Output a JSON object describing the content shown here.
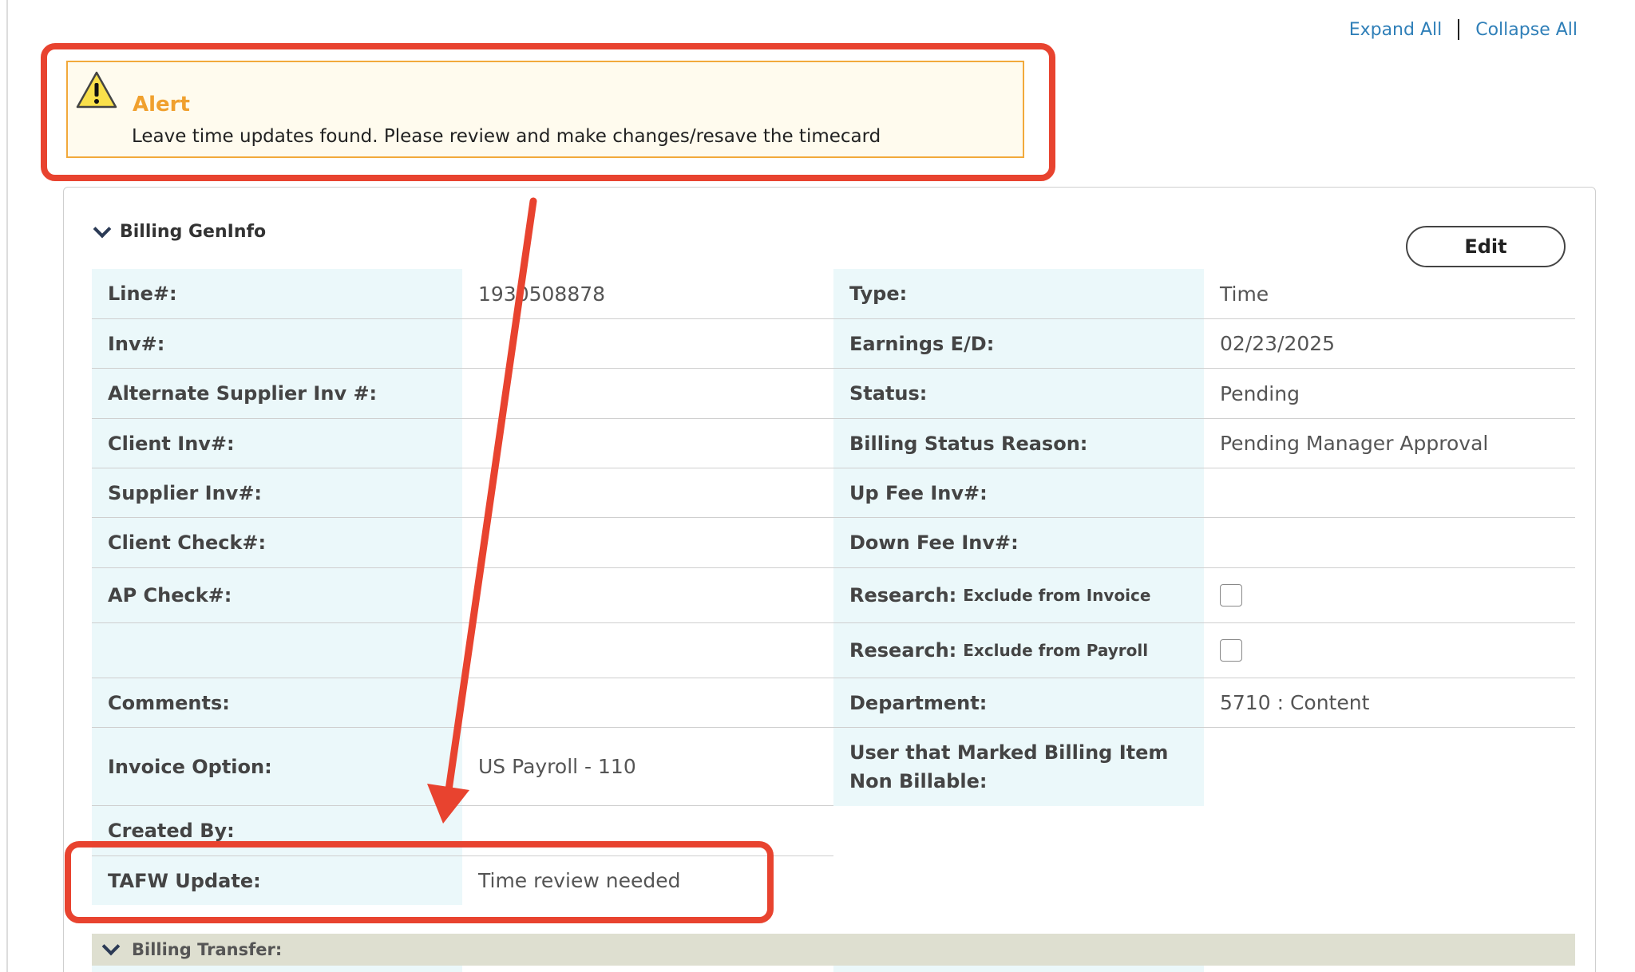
{
  "top_links": {
    "expand_all": "Expand All",
    "collapse_all": "Collapse All"
  },
  "alert": {
    "icon": "warning-triangle-icon",
    "title": "Alert",
    "message": "Leave time updates found. Please review and make changes/resave the timecard"
  },
  "section": {
    "title": "Billing GenInfo",
    "edit_label": "Edit"
  },
  "left_rows": [
    {
      "label": "Line#:",
      "value": "1930508878"
    },
    {
      "label": "Inv#:",
      "value": ""
    },
    {
      "label": "Alternate Supplier Inv #:",
      "value": ""
    },
    {
      "label": "Client Inv#:",
      "value": ""
    },
    {
      "label": "Supplier Inv#:",
      "value": ""
    },
    {
      "label": "Client Check#:",
      "value": ""
    },
    {
      "label": "AP Check#:",
      "value": ""
    },
    {
      "label": "",
      "value": ""
    },
    {
      "label": "Comments:",
      "value": ""
    },
    {
      "label": "Invoice Option:",
      "value": "US Payroll - 110"
    },
    {
      "label": "Created By:",
      "value": ""
    },
    {
      "label": "TAFW Update:",
      "value": "Time review needed"
    }
  ],
  "right_rows": [
    {
      "label": "Type:",
      "value": "Time"
    },
    {
      "label": "Earnings E/D:",
      "value": "02/23/2025"
    },
    {
      "label": "Status:",
      "value": "Pending"
    },
    {
      "label": "Billing Status Reason:",
      "value": "Pending Manager Approval"
    },
    {
      "label": "Up Fee Inv#:",
      "value": ""
    },
    {
      "label": "Down Fee Inv#:",
      "value": ""
    },
    {
      "label": "Research:",
      "sublabel": "Exclude from Invoice",
      "checked": false
    },
    {
      "label": "Research:",
      "sublabel": "Exclude from Payroll",
      "checked": false
    },
    {
      "label": "Department:",
      "value": "5710 : Content"
    },
    {
      "label": "User that Marked Billing Item Non Billable:",
      "value": ""
    }
  ],
  "transfer": {
    "title": "Billing Transfer:"
  },
  "colors": {
    "annotation_red": "#e8432f",
    "label_bg": "#ebf8fa",
    "alert_orange": "#f0a02e",
    "link_blue": "#2f7fb8"
  }
}
